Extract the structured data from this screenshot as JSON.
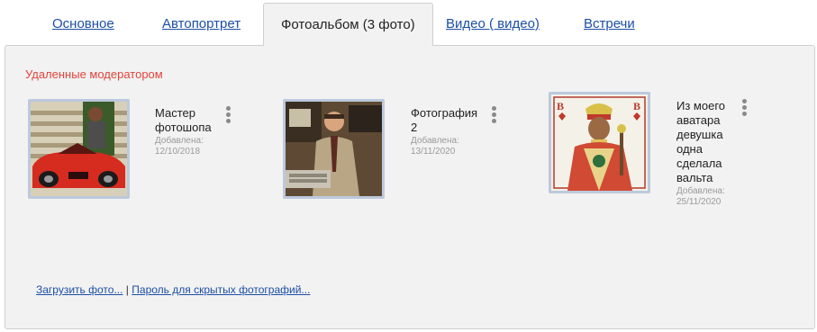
{
  "tabs": [
    {
      "label": "Основное",
      "active": false
    },
    {
      "label": "Автопортрет",
      "active": false
    },
    {
      "label": "Фотоальбом (3 фото)",
      "active": true
    },
    {
      "label": "Видео ( видео)",
      "active": false
    },
    {
      "label": "Встречи",
      "active": false
    }
  ],
  "section": {
    "removed_label": "Удаленные модератором"
  },
  "photos": [
    {
      "title": "Мастер фотошопа",
      "added_label": "Добавлена:",
      "date": "12/10/2018"
    },
    {
      "title": "Фотография 2",
      "added_label": "Добавлена:",
      "date": "13/11/2020"
    },
    {
      "title": "Из моего аватара девушка одна сделала вальта",
      "added_label": "Добавлена:",
      "date": "25/11/2020"
    }
  ],
  "footer": {
    "upload_link": "Загрузить фото...",
    "separator": "|",
    "password_link": "Пароль для скрытых фотографий..."
  },
  "colors": {
    "link": "#1c4fa6",
    "removed_label": "#e0443a",
    "panel_bg": "#f2f2f2",
    "photo_border": "#bcc9dd"
  }
}
